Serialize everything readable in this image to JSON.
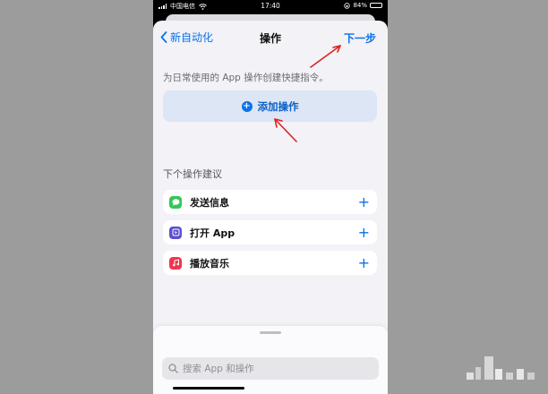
{
  "status_bar": {
    "carrier": "中国电信",
    "time": "17:40",
    "battery": "84%",
    "battery_level": 0.84
  },
  "nav": {
    "back_label": "新自动化",
    "title": "操作",
    "next_label": "下一步"
  },
  "description": "为日常使用的 App 操作创建快捷指令。",
  "add_action_label": "添加操作",
  "suggestions": {
    "header": "下个操作建议",
    "items": [
      {
        "label": "发送信息",
        "icon": "messages-icon",
        "color": "#34c759"
      },
      {
        "label": "打开 App",
        "icon": "open-app-icon",
        "color": "#5a4fcf"
      },
      {
        "label": "播放音乐",
        "icon": "music-icon",
        "color": "#f0364c"
      }
    ]
  },
  "search": {
    "placeholder": "搜索 App 和操作"
  },
  "colors": {
    "accent": "#0a72e8",
    "annotation_arrow": "#e02020"
  }
}
